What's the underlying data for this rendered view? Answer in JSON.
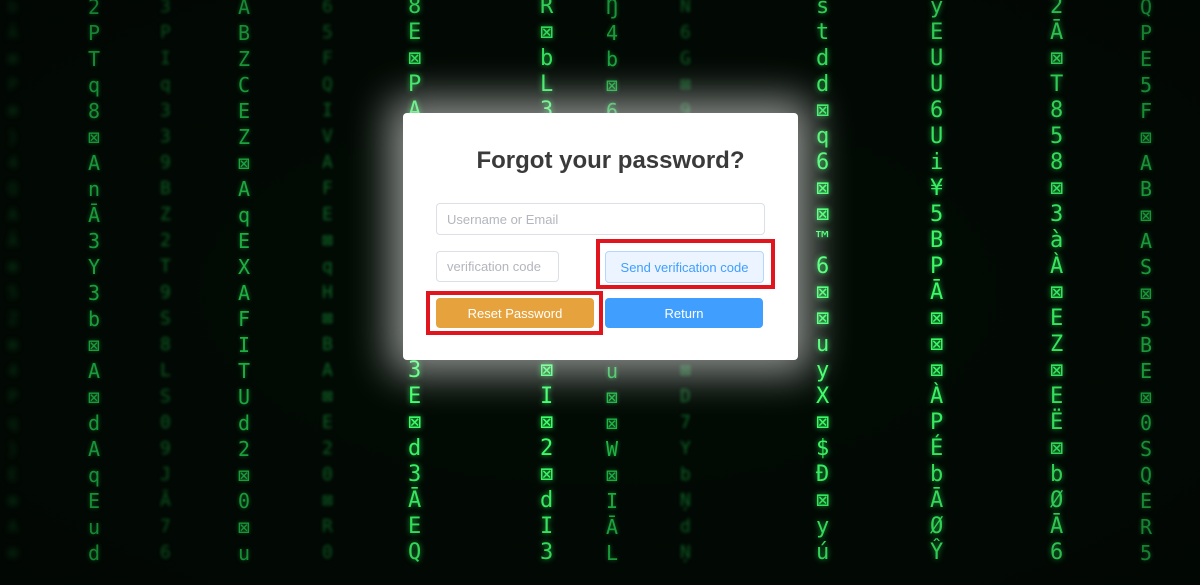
{
  "background": {
    "columns": [
      "b\nĀ\n⊠\nP\n⊠\n}\n4\nQ\nA\nĀ\n⊠\n5\nZ\n⊠\n4\nP\nq\n}\nE\n⊠\nA\n⊠",
      "2\nP\nT\nq\n8\n⊠\nA\nn\nĀ\n3\nY\n3\nb\n⊠\nA\n⊠\nd\nA\nq\nE\nu\nd",
      "3\nP\nI\nq\n3\n3\n9\nB\nZ\n2\nT\n9\nS\n8\nL\nS\n0\n9\nJ\nĀ\n7\n6",
      "Ä\nB\nZ\nC\nE\nZ\n⊠\nA\nq\nE\nX\nA\nF\nI\nT\nU\nd\n2\n⊠\n0\n⊠\nu",
      "6\n5\nF\nQ\nI\nV\nA\nF\nE\n⊠\nq\nH\n⊠\nB\nA\n⊠\nE\n2\n0\n⊠\nR\n0",
      "8\nE\n⊠\nP\nA\nd\n9\nP\nE\nZ\n⊠\nH\n3\n5\n3\nE\n⊠\nd\n3\nĀ\nE\nQ",
      "R\n⊠\nb\nL\n3\nI\nA\n⊠\nu\nd\n⊠\n8\n⊠\n5\n⊠\nI\n⊠\n2\n⊠\nd\nI\n3",
      "Ŋ\n4\nb\n⊠\n6\n4\n6\nR\n⊠\n⊠\nI\n6\n0\nĀ\nu\n⊠\n⊠\nW\n⊠\nI\nĀ\nL",
      "Ň\n6\nG\n⊠\n9\n9\nĀ\nJ\n3\nJ\nd\n⊠\n4\n9\n⊠\nD\n7\nY\nb\nŅ\nd\nŅ",
      "s\nt\nd\nd\n⊠\nq\n6\n⊠\n⊠\n™\n6\n⊠\n⊠\nu\ny\nX\n⊠\n$\nĐ\n⊠\ny\nú",
      "y\nE\nU\nU\n6\nU\ni\n¥\n5\nB\nP\nĀ\n⊠\n⊠\n⊠\nÀ\nP\nÉ\nb\nĀ\nØ\nŶ",
      "2\nĀ\n⊠\nT\n8\n5\n8\n⊠\n3\nà\nÀ\n⊠\nE\nZ\n⊠\nE\nË\n⊠\nb\nØ\nĀ\n6",
      "Q\nP\nE\n5\nF\n⊠\nA\nB\n⊠\nA\nS\n⊠\n5\nB\nE\n⊠\n0\nS\nQ\nE\nR\n5"
    ]
  },
  "form": {
    "title": "Forgot your password?",
    "username_placeholder": "Username or Email",
    "username_value": "",
    "code_placeholder": "verification code",
    "code_value": "",
    "send_code_label": "Send verification code",
    "reset_label": "Reset Password",
    "return_label": "Return"
  },
  "colors": {
    "send_button_bg": "#ecf5ff",
    "send_button_text": "#409eff",
    "reset_button_bg": "#e6a23c",
    "return_button_bg": "#409eff",
    "highlight": "#e0151d"
  }
}
